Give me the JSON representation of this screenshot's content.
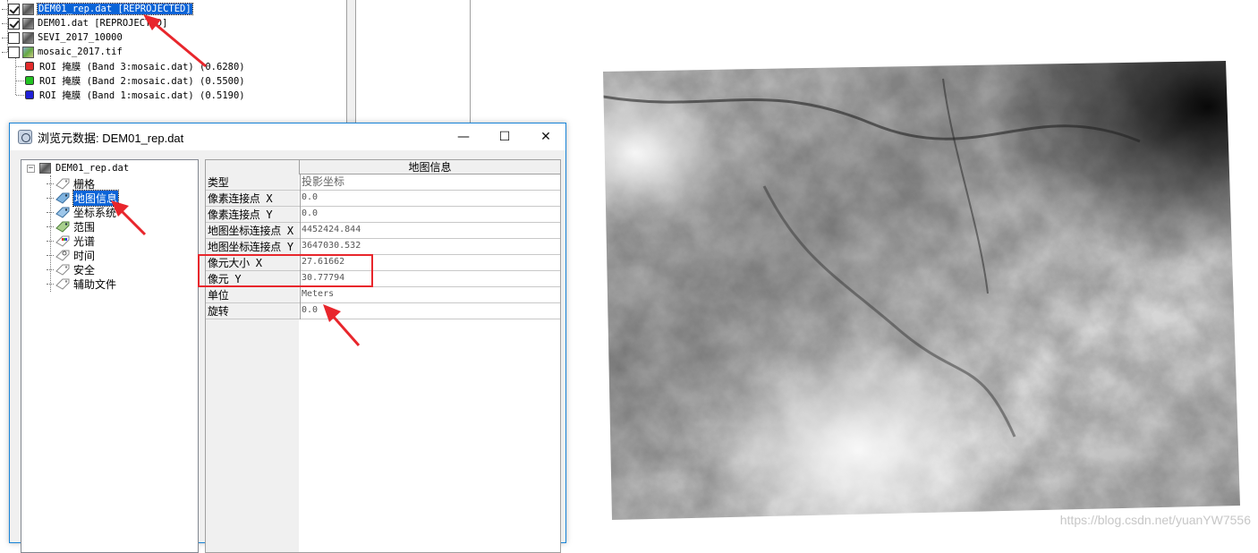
{
  "layers": [
    {
      "label": "DEM01_rep.dat [REPROJECTED]",
      "checked": true,
      "selected": true,
      "icon": "raster-icon"
    },
    {
      "label": "DEM01.dat [REPROJECTED]",
      "checked": true,
      "selected": false,
      "icon": "raster-icon"
    },
    {
      "label": "SEVI_2017_10000",
      "checked": false,
      "selected": false,
      "icon": "raster-icon"
    },
    {
      "label": "mosaic_2017.tif",
      "checked": false,
      "selected": false,
      "icon": "color-raster-icon"
    }
  ],
  "rois": [
    {
      "label": "ROI 掩膜 (Band 3:mosaic.dat) (0.6280)",
      "color": "#e32b2b"
    },
    {
      "label": "ROI 掩膜 (Band 2:mosaic.dat) (0.5500)",
      "color": "#22c322"
    },
    {
      "label": "ROI 掩膜 (Band 1:mosaic.dat) (0.5190)",
      "color": "#2020d8"
    }
  ],
  "dialog": {
    "title": "浏览元数据: DEM01_rep.dat",
    "minimize": "—",
    "maximize": "☐",
    "close": "✕",
    "tree": {
      "root": "DEM01_rep.dat",
      "items": [
        "栅格",
        "地图信息",
        "坐标系统",
        "范围",
        "光谱",
        "时间",
        "安全",
        "辅助文件"
      ],
      "selected_index": 1
    },
    "grid": {
      "header": "地图信息",
      "rows": [
        {
          "key": "类型",
          "value": "投影坐标"
        },
        {
          "key": "像素连接点 X",
          "value": "0.0"
        },
        {
          "key": "像素连接点 Y",
          "value": "0.0"
        },
        {
          "key": "地图坐标连接点 X",
          "value": "4452424.844"
        },
        {
          "key": "地图坐标连接点 Y",
          "value": "3647030.532"
        },
        {
          "key": "像元大小 X",
          "value": "27.61662"
        },
        {
          "key": "像元 Y",
          "value": "30.77794"
        },
        {
          "key": "单位",
          "value": "Meters"
        },
        {
          "key": "旋转",
          "value": "0.0"
        }
      ]
    }
  },
  "watermark": "https://blog.csdn.net/yuanYW7556",
  "colors": {
    "selection": "#0a64d8",
    "annotation_red": "#e8262c",
    "dialog_border": "#1883d7"
  }
}
